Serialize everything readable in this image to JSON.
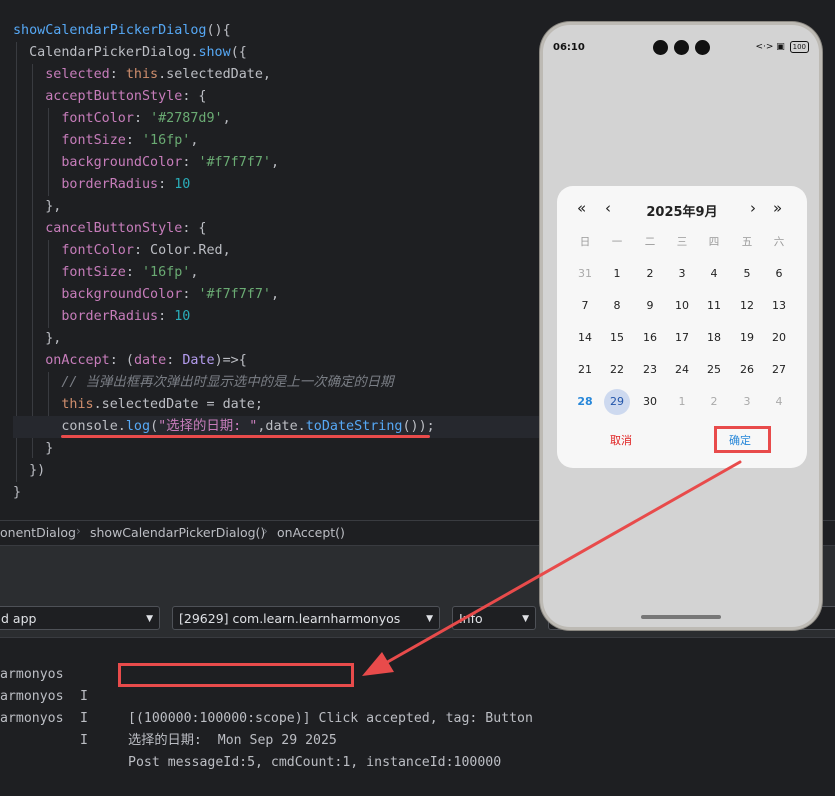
{
  "code": {
    "lines": [
      [
        [
          "t-func",
          "showCalendarPickerDialog"
        ],
        [
          "t-text",
          "(){"
        ]
      ],
      [
        [
          "t-text",
          "  CalendarPickerDialog."
        ],
        [
          "t-func",
          "show"
        ],
        [
          "t-text",
          "({"
        ]
      ],
      [
        [
          "t-text",
          "    "
        ],
        [
          "t-prop",
          "selected"
        ],
        [
          "t-text",
          ": "
        ],
        [
          "t-kw",
          "this"
        ],
        [
          "t-text",
          ".selectedDate,"
        ]
      ],
      [
        [
          "t-text",
          "    "
        ],
        [
          "t-prop",
          "acceptButtonStyle"
        ],
        [
          "t-text",
          ": {"
        ]
      ],
      [
        [
          "t-text",
          "      "
        ],
        [
          "t-prop",
          "fontColor"
        ],
        [
          "t-text",
          ": "
        ],
        [
          "t-str",
          "'#2787d9'"
        ],
        [
          "t-text",
          ","
        ]
      ],
      [
        [
          "t-text",
          "      "
        ],
        [
          "t-prop",
          "fontSize"
        ],
        [
          "t-text",
          ": "
        ],
        [
          "t-str",
          "'16fp'"
        ],
        [
          "t-text",
          ","
        ]
      ],
      [
        [
          "t-text",
          "      "
        ],
        [
          "t-prop",
          "backgroundColor"
        ],
        [
          "t-text",
          ": "
        ],
        [
          "t-str",
          "'#f7f7f7'"
        ],
        [
          "t-text",
          ","
        ]
      ],
      [
        [
          "t-text",
          "      "
        ],
        [
          "t-prop",
          "borderRadius"
        ],
        [
          "t-text",
          ": "
        ],
        [
          "t-num",
          "10"
        ]
      ],
      [
        [
          "t-text",
          "    },"
        ]
      ],
      [
        [
          "t-text",
          "    "
        ],
        [
          "t-prop",
          "cancelButtonStyle"
        ],
        [
          "t-text",
          ": {"
        ]
      ],
      [
        [
          "t-text",
          "      "
        ],
        [
          "t-prop",
          "fontColor"
        ],
        [
          "t-text",
          ": Color.Red,"
        ]
      ],
      [
        [
          "t-text",
          "      "
        ],
        [
          "t-prop",
          "fontSize"
        ],
        [
          "t-text",
          ": "
        ],
        [
          "t-str",
          "'16fp'"
        ],
        [
          "t-text",
          ","
        ]
      ],
      [
        [
          "t-text",
          "      "
        ],
        [
          "t-prop",
          "backgroundColor"
        ],
        [
          "t-text",
          ": "
        ],
        [
          "t-str",
          "'#f7f7f7'"
        ],
        [
          "t-text",
          ","
        ]
      ],
      [
        [
          "t-text",
          "      "
        ],
        [
          "t-prop",
          "borderRadius"
        ],
        [
          "t-text",
          ": "
        ],
        [
          "t-num",
          "10"
        ]
      ],
      [
        [
          "t-text",
          "    },"
        ]
      ],
      [
        [
          "t-text",
          "    "
        ],
        [
          "t-prop",
          "onAccept"
        ],
        [
          "t-text",
          ": ("
        ],
        [
          "t-prop",
          "date"
        ],
        [
          "t-text",
          ": "
        ],
        [
          "t-type",
          "Date"
        ],
        [
          "t-text",
          ")=>{"
        ]
      ],
      [
        [
          "t-text",
          "      "
        ],
        [
          "t-cmt",
          "// 当弹出框再次弹出时显示选中的是上一次确定的日期"
        ]
      ],
      [
        [
          "t-text",
          "      "
        ],
        [
          "t-kw",
          "this"
        ],
        [
          "t-text",
          ".selectedDate = date;"
        ]
      ],
      [
        [
          "t-text",
          "      console."
        ],
        [
          "t-func",
          "log"
        ],
        [
          "t-text",
          "("
        ],
        [
          "t-strpurple",
          "\"选择的日期: \""
        ],
        [
          "t-text",
          ",date."
        ],
        [
          "t-func",
          "toDateString"
        ],
        [
          "t-text",
          "());"
        ]
      ],
      [
        [
          "t-text",
          "    }"
        ]
      ],
      [
        [
          "t-text",
          "  })"
        ]
      ],
      [
        [
          "t-text",
          "}"
        ]
      ]
    ]
  },
  "breadcrumb": {
    "items": [
      "onentDialog",
      "showCalendarPickerDialog()",
      "onAccept()"
    ]
  },
  "filters": {
    "process": "d app",
    "package": "[29629] com.learn.learnharmonyos",
    "level": "Info"
  },
  "log": {
    "lines": [
      {
        "tag": "armonyos",
        "level": "I",
        "msg": "[(100000:100000:scope)] Click accepted, tag: Button"
      },
      {
        "tag": "armonyos",
        "level": "I",
        "msg": "选择的日期:  Mon Sep 29 2025"
      },
      {
        "tag": "armonyos",
        "level": "I",
        "msg": "Post messageId:5, cmdCount:1, instanceId:100000"
      }
    ]
  },
  "phone": {
    "time": "06:10",
    "status_icons": "<·> ▣",
    "battery": "100"
  },
  "calendar": {
    "title": "2025年9月",
    "nav": {
      "prev_year": "«",
      "prev_month": "‹",
      "next_month": "›",
      "next_year": "»"
    },
    "weekdays": [
      "日",
      "一",
      "二",
      "三",
      "四",
      "五",
      "六"
    ],
    "weeks": [
      [
        {
          "d": "31",
          "s": "muted"
        },
        {
          "d": "1"
        },
        {
          "d": "2"
        },
        {
          "d": "3"
        },
        {
          "d": "4"
        },
        {
          "d": "5"
        },
        {
          "d": "6"
        }
      ],
      [
        {
          "d": "7"
        },
        {
          "d": "8"
        },
        {
          "d": "9"
        },
        {
          "d": "10"
        },
        {
          "d": "11"
        },
        {
          "d": "12"
        },
        {
          "d": "13"
        }
      ],
      [
        {
          "d": "14"
        },
        {
          "d": "15"
        },
        {
          "d": "16"
        },
        {
          "d": "17"
        },
        {
          "d": "18"
        },
        {
          "d": "19"
        },
        {
          "d": "20"
        }
      ],
      [
        {
          "d": "21"
        },
        {
          "d": "22"
        },
        {
          "d": "23"
        },
        {
          "d": "24"
        },
        {
          "d": "25"
        },
        {
          "d": "26"
        },
        {
          "d": "27"
        }
      ],
      [
        {
          "d": "28",
          "s": "today"
        },
        {
          "d": "29",
          "s": "selected"
        },
        {
          "d": "30"
        },
        {
          "d": "1",
          "s": "muted"
        },
        {
          "d": "2",
          "s": "muted"
        },
        {
          "d": "3",
          "s": "muted"
        },
        {
          "d": "4",
          "s": "muted"
        }
      ]
    ],
    "cancel_label": "取消",
    "accept_label": "确定"
  },
  "colors": {
    "accept": "#2787d9",
    "cancel": "#e02020",
    "annotation": "#e84b4b",
    "editor_bg": "#1e1f22"
  }
}
